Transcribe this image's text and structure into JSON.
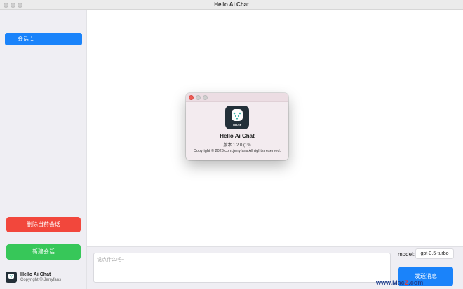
{
  "window": {
    "title": "Hello Ai Chat"
  },
  "sidebar": {
    "sessions": [
      {
        "label": "会话 1"
      }
    ],
    "delete_label": "删除当前会话",
    "new_label": "新建会话",
    "brand": {
      "name": "Hello Ai Chat",
      "copyright": "Copyright © Jerryfans"
    }
  },
  "composer": {
    "placeholder": "说点什么吧~",
    "model_label": "model:",
    "model_value": "gpt-3.5-turbo",
    "send_label": "发送消息"
  },
  "about_dialog": {
    "app_name": "Hello Ai Chat",
    "version": "版本 1.2.0 (19)",
    "copyright": "Copyright © 2023 com.jerryfans All rights reserved.",
    "icon_text": "CHAT"
  },
  "watermark": {
    "prefix": "www.Mac",
    "accent": "Z",
    "suffix": ".com"
  },
  "colors": {
    "accent_blue": "#1a83fa",
    "danger_red": "#f2473c",
    "success_green": "#37c759",
    "icon_dark": "#233039"
  }
}
